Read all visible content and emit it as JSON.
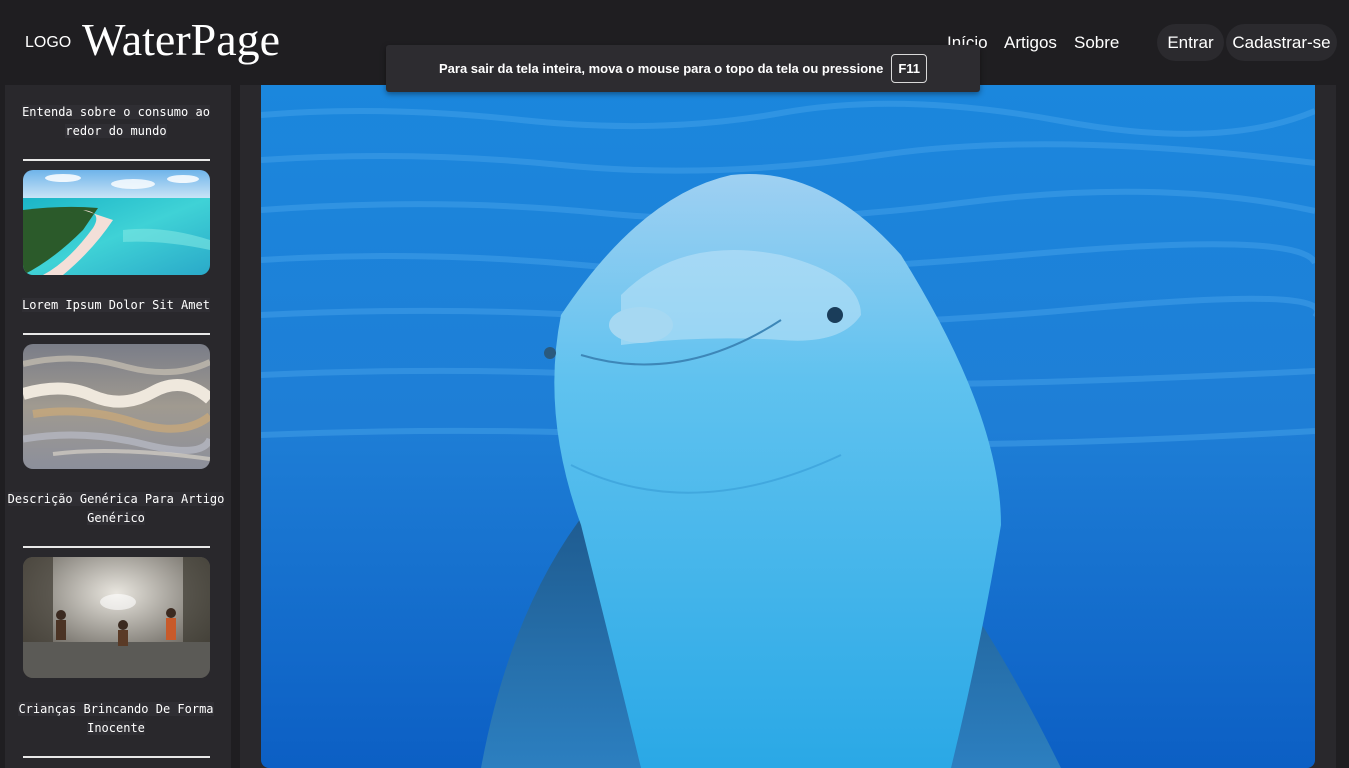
{
  "header": {
    "logo_small": "LOGO",
    "logo_title": "WaterPage",
    "nav": [
      "Início",
      "Artigos",
      "Sobre"
    ],
    "login_label": "Entrar",
    "signup_label": "Cadastrar-se"
  },
  "fullscreen_toast": {
    "message": "Para sair da tela inteira, mova o mouse para o topo da tela ou pressione",
    "key": "F11"
  },
  "sidebar": {
    "items": [
      {
        "title": "Entenda sobre o consumo ao redor do mundo"
      },
      {
        "title": "Lorem Ipsum Dolor Sit Amet",
        "image": "tropical-beach-photo"
      },
      {
        "title": "Descrição Genérica Para Artigo Genérico",
        "image": "river-water-photo"
      },
      {
        "title": "Crianças Brincando De Forma Inocente",
        "image": "children-playing-water-photo"
      }
    ]
  },
  "main": {
    "image": "dolphin-underwater-photo"
  },
  "colors": {
    "background": "#1f1e21",
    "panel": "#29282c",
    "ocean": "#1a7fd8"
  }
}
